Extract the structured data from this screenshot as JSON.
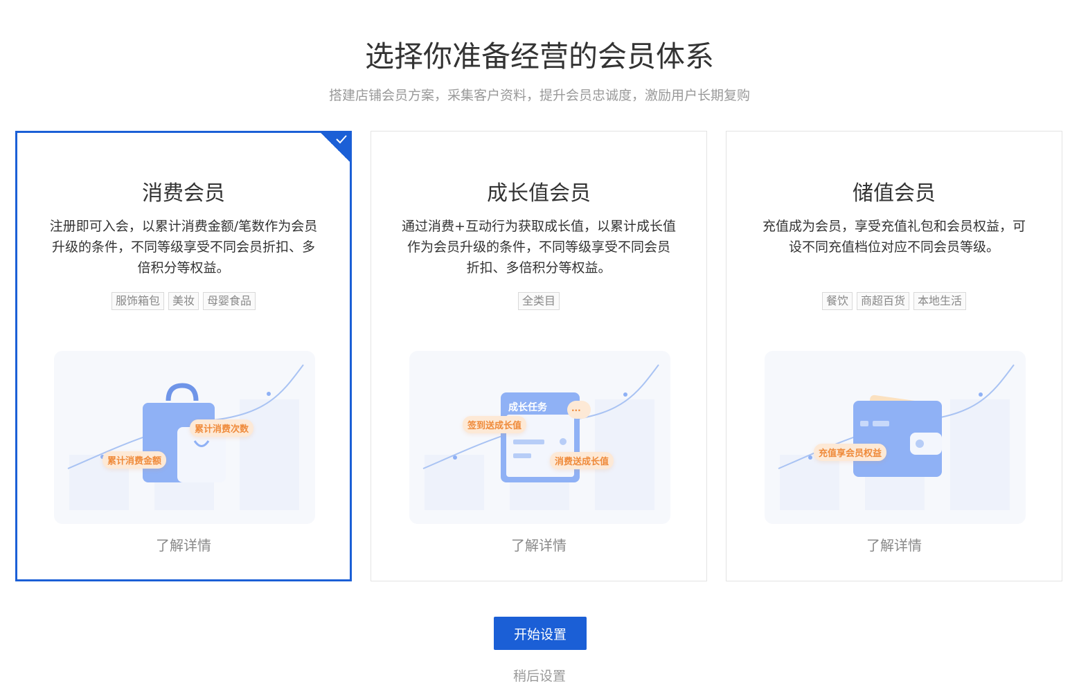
{
  "header": {
    "title": "选择你准备经营的会员体系",
    "subtitle": "搭建店铺会员方案，采集客户资料，提升会员忠诚度，激励用户长期复购"
  },
  "cards": [
    {
      "title": "消费会员",
      "description": "注册即可入会，以累计消费金额/笔数作为会员升级的条件，不同等级享受不同会员折扣、多倍积分等权益。",
      "tags": [
        "服饰箱包",
        "美妆",
        "母婴食品"
      ],
      "illustration_labels": [
        "累计消费次数",
        "累计消费金额"
      ],
      "detail_label": "了解详情",
      "selected": true
    },
    {
      "title": "成长值会员",
      "description": "通过消费+互动行为获取成长值，以累计成长值作为会员升级的条件，不同等级享受不同会员折扣、多倍积分等权益。",
      "tags": [
        "全类目"
      ],
      "illustration_labels": [
        "成长任务",
        "签到送成长值",
        "消费送成长值",
        "..."
      ],
      "detail_label": "了解详情",
      "selected": false
    },
    {
      "title": "储值会员",
      "description": "充值成为会员，享受充值礼包和会员权益，可设不同充值档位对应不同会员等级。",
      "tags": [
        "餐饮",
        "商超百货",
        "本地生活"
      ],
      "illustration_labels": [
        "充值享会员权益"
      ],
      "detail_label": "了解详情",
      "selected": false
    }
  ],
  "actions": {
    "start_label": "开始设置",
    "later_label": "稍后设置"
  },
  "colors": {
    "primary": "#1b5fd6",
    "border": "#e3e3e3",
    "tag_text": "#888888",
    "pill_bg": "#fde9d6",
    "pill_text": "#ef8a3a",
    "illus_blue": "#8fb1f5"
  },
  "icons": [
    "check-icon",
    "shopping-bag-icon",
    "task-card-icon",
    "wallet-icon"
  ]
}
